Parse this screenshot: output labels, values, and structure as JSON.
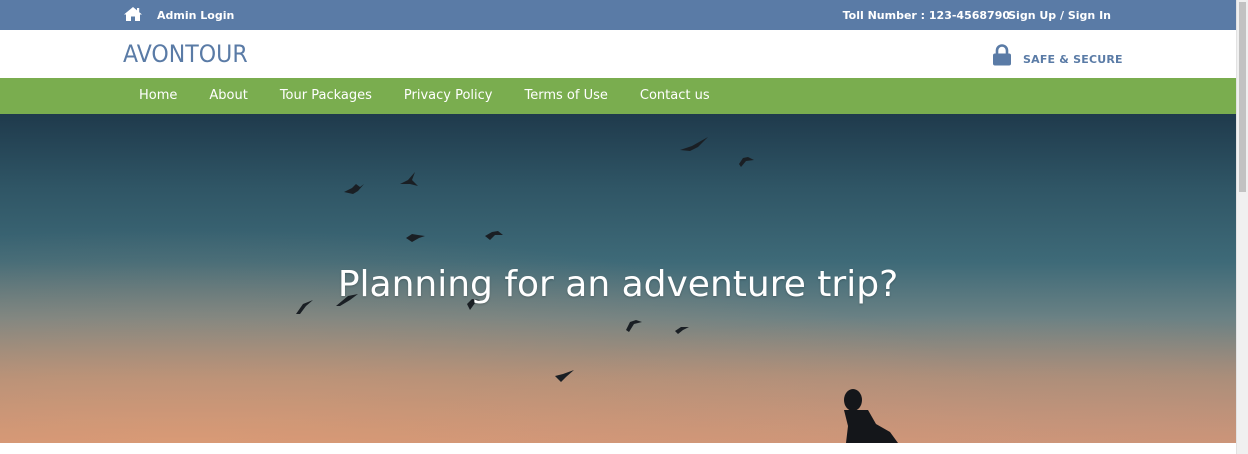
{
  "topbar": {
    "home_icon": "home-icon",
    "admin_login": "Admin Login",
    "toll_number": "Toll Number : 123-4568790",
    "signup_signin": "Sign Up / Sign In"
  },
  "header": {
    "logo": "AVONTOUR",
    "lock_icon": "lock-icon",
    "secure_text": "SAFE & SECURE"
  },
  "nav": {
    "items": [
      {
        "label": "Home"
      },
      {
        "label": "About"
      },
      {
        "label": "Tour Packages"
      },
      {
        "label": "Privacy Policy"
      },
      {
        "label": "Terms of Use"
      },
      {
        "label": "Contact us"
      }
    ]
  },
  "hero": {
    "title": "Planning for an adventure trip?"
  },
  "colors": {
    "topbar": "#5a7ba6",
    "nav": "#7aad4f",
    "logo": "#5a7ba6",
    "white": "#ffffff"
  }
}
